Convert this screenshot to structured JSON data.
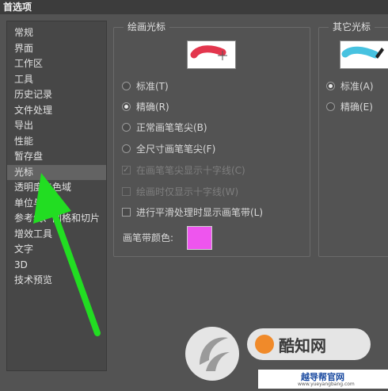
{
  "window": {
    "title": "首选项"
  },
  "sidebar": {
    "items": [
      {
        "label": "常规"
      },
      {
        "label": "界面"
      },
      {
        "label": "工作区"
      },
      {
        "label": "工具"
      },
      {
        "label": "历史记录"
      },
      {
        "label": "文件处理"
      },
      {
        "label": "导出"
      },
      {
        "label": "性能"
      },
      {
        "label": "暂存盘"
      },
      {
        "label": "光标"
      },
      {
        "label": "透明度与色域"
      },
      {
        "label": "单位与标尺"
      },
      {
        "label": "参考线、网格和切片"
      },
      {
        "label": "增效工具"
      },
      {
        "label": "文字"
      },
      {
        "label": "3D"
      },
      {
        "label": "技术预览"
      }
    ],
    "selected_index": 9
  },
  "painting_cursors": {
    "title": "绘画光标",
    "options": [
      {
        "label": "标准(T)",
        "selected": false
      },
      {
        "label": "精确(R)",
        "selected": true
      },
      {
        "label": "正常画笔笔尖(B)",
        "selected": false
      },
      {
        "label": "全尺寸画笔笔尖(F)",
        "selected": false
      }
    ],
    "show_crosshair": {
      "label": "在画笔笔尖显示十字线(C)",
      "checked": true,
      "disabled": true
    },
    "crosshair_while_painting": {
      "label": "绘画时仅显示十字线(W)",
      "checked": false,
      "disabled": true
    },
    "show_brush_strip": {
      "label": "进行平滑处理时显示画笔带(L)",
      "checked": false,
      "disabled": false
    },
    "brush_strip_color_label": "画笔带颜色:",
    "brush_strip_color": "#ee55ee"
  },
  "other_cursors": {
    "title": "其它光标",
    "options": [
      {
        "label": "标准(A)",
        "selected": true
      },
      {
        "label": "精确(E)",
        "selected": false
      }
    ]
  },
  "colors": {
    "arrow": "#22dd22",
    "painting_preview_stroke": "#e0203a",
    "other_preview_stroke": "#33bbdd"
  },
  "watermark": {
    "brand": "酷知网",
    "site_text": "越导帮官网",
    "url": "www.yueyangbang.com"
  }
}
